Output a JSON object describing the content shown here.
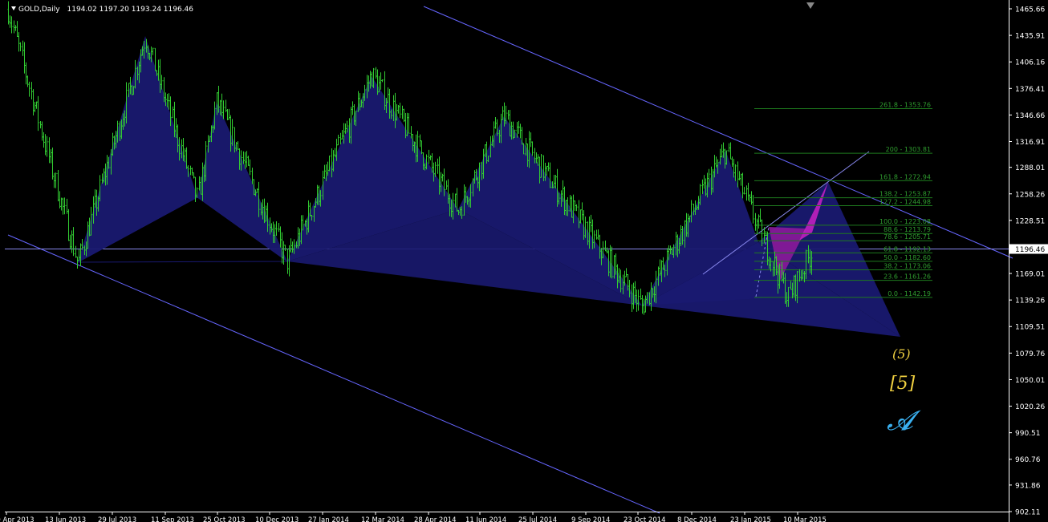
{
  "header": {
    "symbol": "GOLD,Daily",
    "open": "1194.02",
    "high": "1197.20",
    "low": "1193.24",
    "close": "1196.46"
  },
  "colors": {
    "background": "#000000",
    "candle": "#32cd32",
    "pattern_fill": "#191970",
    "abcd_fill": "#8b1a9a",
    "channel": "#6666ff",
    "fib": "#1e7a1e",
    "fib_text": "#2f9e2f",
    "axis": "#ffffff",
    "wave_labels": "#f0d040",
    "ewave_logo": "#3ab0f0"
  },
  "annotations": {
    "wave_paren": "(5)",
    "wave_bracket": "[5]",
    "ewave_symbol": "𝓐"
  },
  "fib_levels": [
    {
      "label": "261.8 - 1353.76",
      "price": 1353.76
    },
    {
      "label": "200 - 1303.81",
      "price": 1303.81
    },
    {
      "label": "161.8 - 1272.94",
      "price": 1272.94
    },
    {
      "label": "138.2 - 1253.87",
      "price": 1253.87
    },
    {
      "label": "127.2 - 1244.98",
      "price": 1244.98
    },
    {
      "label": "100.0 - 1223.08",
      "price": 1223.08
    },
    {
      "label": "88.6 - 1213.79",
      "price": 1213.79
    },
    {
      "label": "78.6 - 1205.71",
      "price": 1205.71
    },
    {
      "label": "61.8 - 1192.13",
      "price": 1192.13
    },
    {
      "label": "50.0 - 1182.60",
      "price": 1182.6
    },
    {
      "label": "38.2 - 1173.06",
      "price": 1173.06
    },
    {
      "label": "23.6 - 1161.26",
      "price": 1161.26
    },
    {
      "label": "0.0 - 1142.19",
      "price": 1142.19
    }
  ],
  "chart_data": {
    "type": "candlestick",
    "title": "GOLD,Daily",
    "ylim": [
      902.11,
      1465.6
    ],
    "y_ticks": [
      "1465.66",
      "1435.91",
      "1406.16",
      "1376.41",
      "1346.66",
      "1316.91",
      "1288.01",
      "1258.26",
      "1228.51",
      "1196.46",
      "1169.01",
      "1139.26",
      "1109.51",
      "1079.76",
      "1050.01",
      "1020.26",
      "990.51",
      "960.76",
      "931.86",
      "902.11"
    ],
    "x_ticks": [
      "30 Apr 2013",
      "13 Jun 2013",
      "29 Jul 2013",
      "11 Sep 2013",
      "25 Oct 2013",
      "10 Dec 2013",
      "27 Jan 2014",
      "12 Mar 2014",
      "28 Apr 2014",
      "11 Jun 2014",
      "25 Jul 2014",
      "9 Sep 2014",
      "23 Oct 2014",
      "8 Dec 2014",
      "23 Jan 2015",
      "10 Mar 2015"
    ],
    "current_price": 1196.46,
    "swing_points": [
      {
        "date": "Apr 2013",
        "price": 1465
      },
      {
        "date": "Jun 2013",
        "price": 1180
      },
      {
        "date": "Aug 2013",
        "price": 1434
      },
      {
        "date": "Oct 2013",
        "price": 1251
      },
      {
        "date": "Oct 2013",
        "price": 1362
      },
      {
        "date": "Dec 2013",
        "price": 1182
      },
      {
        "date": "Mar 2014",
        "price": 1392
      },
      {
        "date": "May 2014",
        "price": 1240
      },
      {
        "date": "Jul 2014",
        "price": 1345
      },
      {
        "date": "Nov 2014",
        "price": 1132
      },
      {
        "date": "Jan 2015",
        "price": 1307
      },
      {
        "date": "Mar 2015",
        "price": 1142
      }
    ]
  }
}
